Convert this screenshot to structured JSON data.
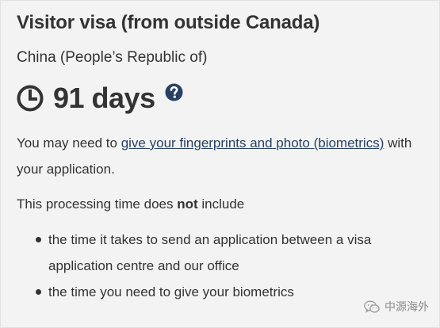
{
  "card": {
    "title": "Visitor visa (from outside Canada)",
    "country": "China (People’s Republic of)",
    "processing_time": "91 days",
    "clock_icon": "clock-icon",
    "help_icon": "question-circle-icon",
    "biometrics": {
      "prefix": "You may need to ",
      "link_text": "give your fingerprints and photo (biometrics)",
      "suffix": " with your application."
    },
    "exclusions": {
      "intro_before": "This processing time does ",
      "intro_bold": "not",
      "intro_after": " include",
      "items": [
        "the time it takes to send an application between a visa application centre and our office",
        "the time you need to give your biometrics"
      ]
    }
  },
  "watermark": {
    "icon": "wechat-icon",
    "text": "中源海外"
  },
  "colors": {
    "card_background": "#f3f3f3",
    "text": "#333333",
    "link": "#284162",
    "help_icon": "#284162"
  }
}
